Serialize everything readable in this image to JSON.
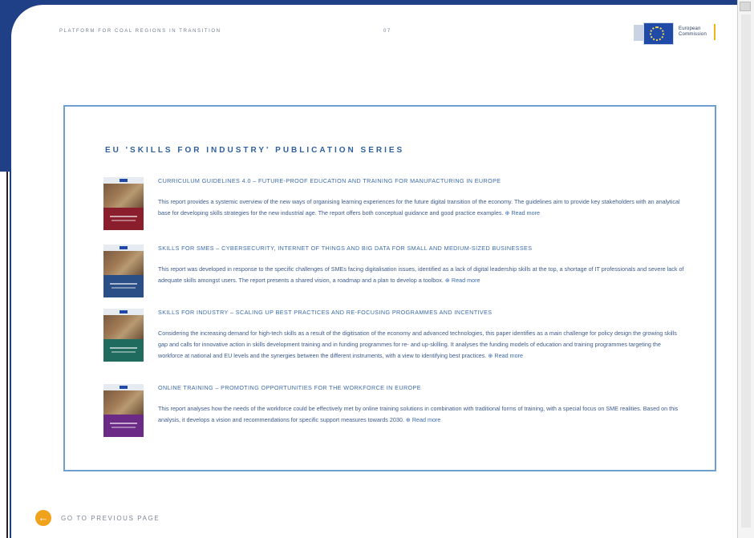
{
  "header": {
    "running_title": "PLATFORM FOR COAL REGIONS IN TRANSITION",
    "page_number": "07",
    "logo_text_line1": "European",
    "logo_text_line2": "Commission"
  },
  "series_title": "EU 'SKILLS FOR INDUSTRY' PUBLICATION SERIES",
  "publications": [
    {
      "title": "CURRICULUM GUIDELINES 4.0 – FUTURE-PROOF EDUCATION AND TRAINING FOR MANUFACTURING IN EUROPE",
      "description": "This report provides a systemic overview of the new ways of organising learning experiences for the future digital transition of the economy. The guidelines aim to provide key stakeholders with an analytical base for developing skills strategies for the new industrial age. The report offers both conceptual guidance and good practice examples.",
      "read_more": "Read more",
      "cover_color": "#8b1e2d"
    },
    {
      "title": "SKILLS FOR SMES – CYBERSECURITY, INTERNET OF THINGS AND BIG DATA FOR SMALL AND MEDIUM-SIZED BUSINESSES",
      "description": "This report was developed in response to the specific challenges of SMEs facing digitalisation issues, identified as a lack of digital leadership skills at the top, a shortage of IT professionals and severe lack of adequate skills amongst users. The report presents a shared vision, a roadmap and a plan to develop a toolbox.",
      "read_more": "Read more",
      "cover_color": "#2a4f86"
    },
    {
      "title": "SKILLS FOR INDUSTRY – SCALING UP BEST PRACTICES AND RE-FOCUSING PROGRAMMES AND INCENTIVES",
      "description": "Considering the increasing demand for high-tech skills as a result of the digitisation of the economy and advanced technologies, this paper identifies as a main challenge for policy design the growing skills gap and calls for innovative action in skills development training and in funding programmes for re- and up-skilling. It analyses the funding models of education and training programmes targeting the workforce at national and EU levels and the synergies between the different instruments, with a view to identifying best practices.",
      "read_more": "Read more",
      "cover_color": "#1f6b5e"
    },
    {
      "title": "ONLINE TRAINING – PROMOTING OPPORTUNITIES FOR THE WORKFORCE IN EUROPE",
      "description": "This report analyses how the needs of the workforce could be effectively met by online training solutions in combination with traditional forms of training, with a special focus on SME realities. Based on this analysis, it develops a vision and recommendations for specific support measures towards 2030.",
      "read_more": "Read more",
      "cover_color": "#6a2a86"
    }
  ],
  "footer": {
    "prev_label": "GO TO PREVIOUS PAGE",
    "prev_icon": "arrow-left-icon"
  },
  "colors": {
    "accent": "#3a6aab",
    "frame": "#6d9fd1",
    "prev_button": "#f0a21b"
  }
}
